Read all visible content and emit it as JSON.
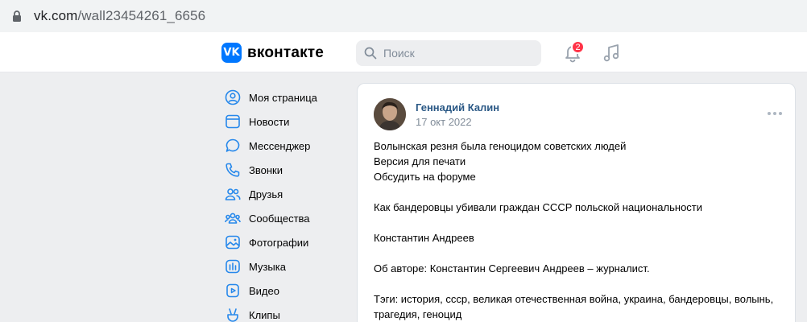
{
  "browser": {
    "url_host": "vk.com",
    "url_path": "/wall23454261_6656"
  },
  "header": {
    "logo_text": "вконтакте",
    "search_placeholder": "Поиск",
    "notifications_count": "2"
  },
  "sidebar": {
    "items": [
      {
        "label": "Моя страница",
        "icon": "user-circle-icon"
      },
      {
        "label": "Новости",
        "icon": "news-icon"
      },
      {
        "label": "Мессенджер",
        "icon": "message-bubble-icon"
      },
      {
        "label": "Звонки",
        "icon": "phone-icon"
      },
      {
        "label": "Друзья",
        "icon": "friends-icon"
      },
      {
        "label": "Сообщества",
        "icon": "communities-icon"
      },
      {
        "label": "Фотографии",
        "icon": "photo-icon"
      },
      {
        "label": "Музыка",
        "icon": "music-icon"
      },
      {
        "label": "Видео",
        "icon": "video-icon"
      },
      {
        "label": "Клипы",
        "icon": "clips-icon"
      }
    ]
  },
  "post": {
    "author": "Геннадий Калин",
    "date": "17 окт 2022",
    "lines": [
      "Волынская резня была геноцидом советских людей",
      "Версия для печати",
      "Обсудить на форуме",
      "",
      "Как бандеровцы убивали граждан СССР польской национальности",
      "",
      "Константин Андреев",
      "",
      "Об авторе: Константин Сергеевич Андреев – журналист.",
      "",
      "Тэги: история, ссср, великая отечественная война, украина, бандеровцы, волынь,",
      "трагедия, геноцид"
    ]
  },
  "colors": {
    "accent": "#0077ff",
    "link": "#2a5885",
    "badge": "#ff3347",
    "background": "#edeef0"
  }
}
